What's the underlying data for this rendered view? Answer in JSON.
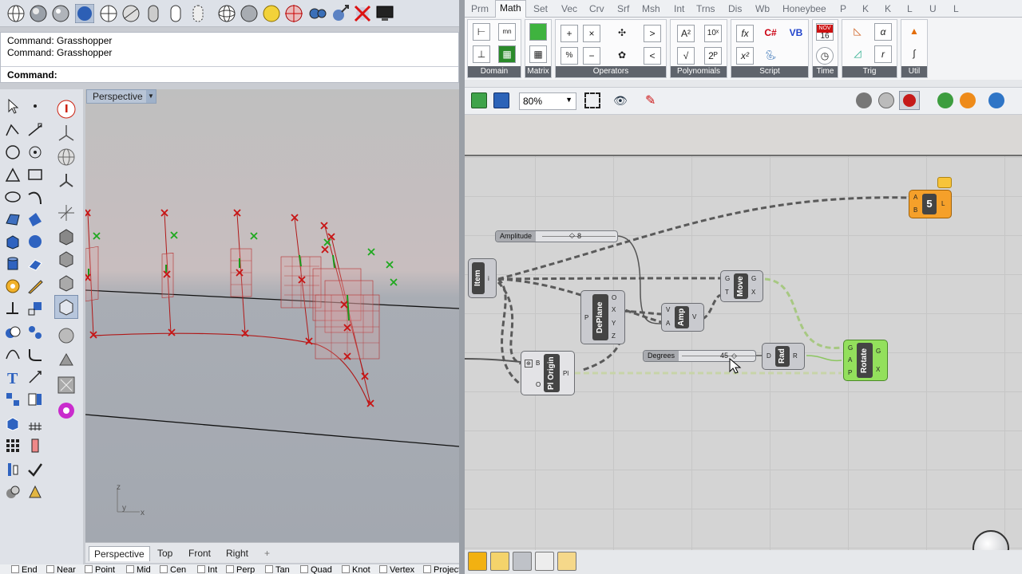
{
  "rhino": {
    "command_history": [
      "Command: Grasshopper",
      "Command: Grasshopper"
    ],
    "command_prompt": "Command:",
    "viewport_title": "Perspective",
    "view_tabs": [
      "Perspective",
      "Top",
      "Front",
      "Right",
      "+"
    ],
    "active_view_tab": "Perspective",
    "axis_labels": {
      "z": "z",
      "y": "y",
      "x": "x"
    },
    "osnaps": [
      "End",
      "Near",
      "Point",
      "Mid",
      "Cen",
      "Int",
      "Perp",
      "Tan",
      "Quad",
      "Knot",
      "Vertex",
      "Project"
    ]
  },
  "grasshopper": {
    "tabs": [
      "Prm",
      "Math",
      "Set",
      "Vec",
      "Crv",
      "Srf",
      "Msh",
      "Int",
      "Trns",
      "Dis",
      "Wb",
      "Honeybee",
      "P",
      "K",
      "K",
      "L",
      "U",
      "L"
    ],
    "active_tab": "Math",
    "groups": [
      "Domain",
      "Matrix",
      "Operators",
      "Polynomials",
      "Script",
      "Time",
      "Trig",
      "Util"
    ],
    "calendar_month": "NOV",
    "calendar_day": "16",
    "zoom": "80%",
    "components": {
      "item": {
        "name": "Item",
        "port_out": "i"
      },
      "amplitude": {
        "name": "Amplitude",
        "value": "8"
      },
      "degrees": {
        "name": "Degrees",
        "value": "45"
      },
      "deplane": {
        "name": "DePlane",
        "inputs": [
          "P"
        ],
        "outputs": [
          "O",
          "X",
          "Y",
          "Z"
        ]
      },
      "amp": {
        "name": "Amp",
        "inputs": [
          "V",
          "A"
        ],
        "outputs": [
          "V"
        ]
      },
      "move": {
        "name": "Move",
        "inputs": [
          "G",
          "T"
        ],
        "outputs": [
          "G",
          "X"
        ]
      },
      "rad": {
        "name": "Rad",
        "inputs": [
          "D"
        ],
        "outputs": [
          "R"
        ]
      },
      "rotate": {
        "name": "Rotate",
        "inputs": [
          "G",
          "A",
          "P"
        ],
        "outputs": [
          "G",
          "X"
        ]
      },
      "pl_origin": {
        "name": "Pl Origin",
        "inputs": [
          "B",
          "O"
        ],
        "outputs": [
          "Pl"
        ]
      },
      "list_len": {
        "inputs": [
          "A",
          "B"
        ],
        "outputs": [
          "L"
        ]
      }
    }
  },
  "colors": {
    "accent": "#ff9a1a",
    "rotate": "#8ee04a",
    "marker_red": "#c81414",
    "marker_green": "#1fa91f"
  }
}
